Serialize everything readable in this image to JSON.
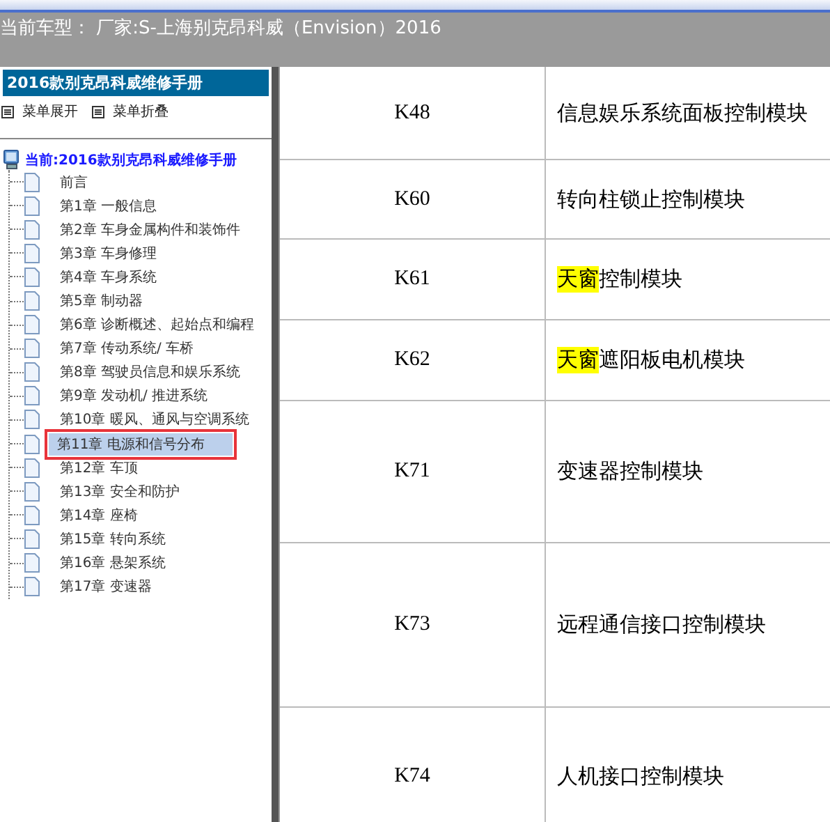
{
  "header": {
    "title": "当前车型： 厂家:S-上海别克昂科威（Envision）2016"
  },
  "sidebar": {
    "title": "2016款别克昂科威维修手册",
    "actions": [
      {
        "label": "菜单展开"
      },
      {
        "label": "菜单折叠"
      }
    ],
    "root": {
      "label": "当前:2016款别克昂科威维修手册",
      "children": [
        {
          "label": "前言",
          "selected": false,
          "marked": false
        },
        {
          "label": "第1章 一般信息",
          "selected": false,
          "marked": false
        },
        {
          "label": "第2章 车身金属构件和装饰件",
          "selected": false,
          "marked": false
        },
        {
          "label": "第3章 车身修理",
          "selected": false,
          "marked": false
        },
        {
          "label": "第4章 车身系统",
          "selected": false,
          "marked": false
        },
        {
          "label": "第5章 制动器",
          "selected": false,
          "marked": false
        },
        {
          "label": "第6章 诊断概述、起始点和编程",
          "selected": false,
          "marked": false
        },
        {
          "label": "第7章 传动系统/ 车桥",
          "selected": false,
          "marked": false
        },
        {
          "label": "第8章 驾驶员信息和娱乐系统",
          "selected": false,
          "marked": false
        },
        {
          "label": "第9章 发动机/ 推进系统",
          "selected": false,
          "marked": false
        },
        {
          "label": "第10章 暖风、通风与空调系统",
          "selected": false,
          "marked": false
        },
        {
          "label": "第11章 电源和信号分布",
          "selected": true,
          "marked": true
        },
        {
          "label": "第12章 车顶",
          "selected": false,
          "marked": false
        },
        {
          "label": "第13章 安全和防护",
          "selected": false,
          "marked": false
        },
        {
          "label": "第14章 座椅",
          "selected": false,
          "marked": false
        },
        {
          "label": "第15章 转向系统",
          "selected": false,
          "marked": false
        },
        {
          "label": "第16章 悬架系统",
          "selected": false,
          "marked": false
        },
        {
          "label": "第17章 变速器",
          "selected": false,
          "marked": false
        }
      ]
    }
  },
  "table": {
    "rows": [
      {
        "code": "K48",
        "name": [
          {
            "text": "信息娱乐系统面板控制模块",
            "highlighted": false
          }
        ]
      },
      {
        "code": "K60",
        "name": [
          {
            "text": "转向柱锁止控制模块",
            "highlighted": false
          }
        ]
      },
      {
        "code": "K61",
        "name": [
          {
            "text": "天窗",
            "highlighted": true
          },
          {
            "text": "控制模块",
            "highlighted": false
          }
        ]
      },
      {
        "code": "K62",
        "name": [
          {
            "text": "天窗",
            "highlighted": true
          },
          {
            "text": "遮阳板电机模块",
            "highlighted": false
          }
        ]
      },
      {
        "code": "K71",
        "name": [
          {
            "text": "变速器控制模块",
            "highlighted": false
          }
        ]
      },
      {
        "code": "K73",
        "name": [
          {
            "text": "远程通信接口控制模块",
            "highlighted": false
          }
        ]
      },
      {
        "code": "K74",
        "name": [
          {
            "text": "人机接口控制模块",
            "highlighted": false
          }
        ]
      }
    ]
  }
}
